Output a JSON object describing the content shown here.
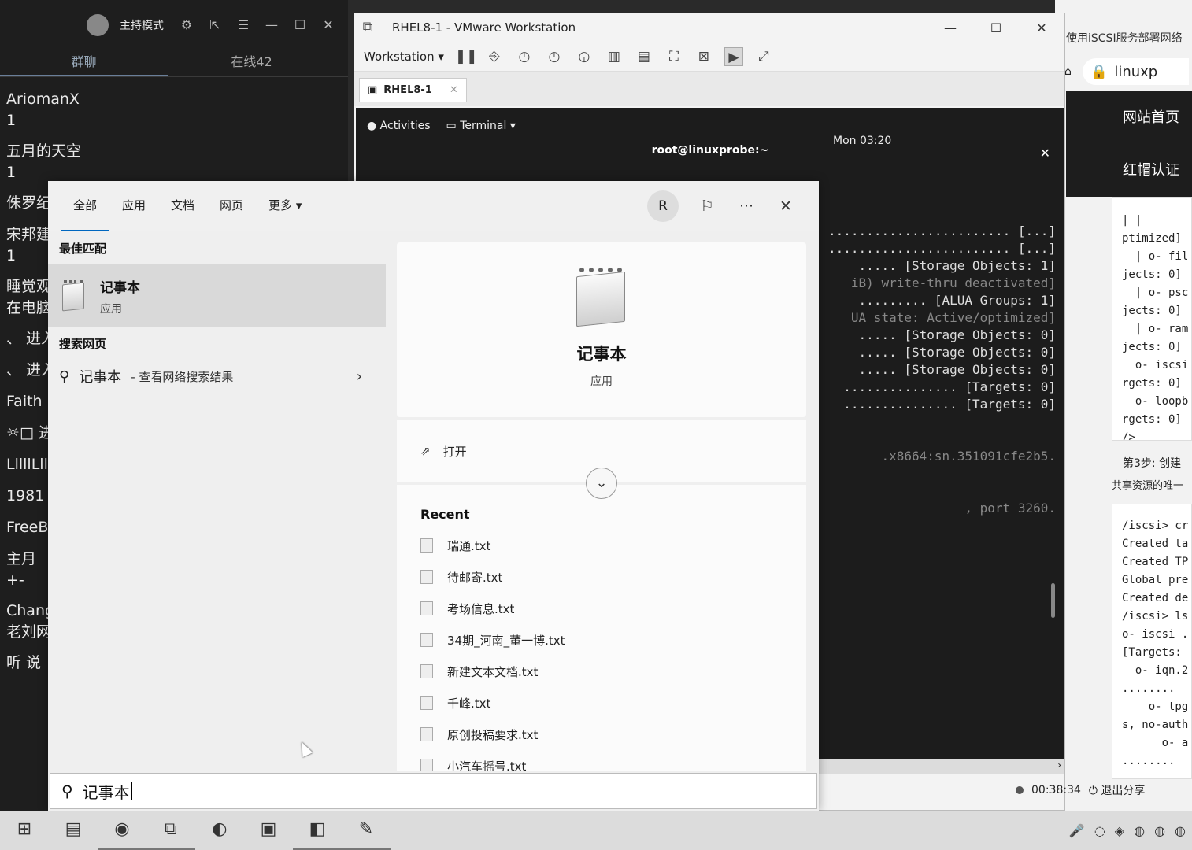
{
  "chat": {
    "mode_label": "主持模式",
    "tabs": [
      "群聊",
      "在线42"
    ],
    "messages": [
      {
        "name": "AriomanX",
        "text": "1"
      },
      {
        "name": "五月的天空",
        "text": "1"
      },
      {
        "name": "侏罗纪",
        "text": ""
      },
      {
        "name": "宋邦建",
        "text": "1"
      },
      {
        "name": "睡觉观",
        "text": "在电脑"
      },
      {
        "name": "、 进入",
        "text": ""
      },
      {
        "name": "、 进入",
        "text": ""
      },
      {
        "name": "Faith",
        "text": ""
      },
      {
        "name": "☼□ 进",
        "text": ""
      },
      {
        "name": "LllllLll",
        "text": ""
      },
      {
        "name": "1981",
        "text": ""
      },
      {
        "name": "FreeB",
        "text": ""
      },
      {
        "name": "主月",
        "text": "+-"
      },
      {
        "name": "Chang",
        "text": "老刘网"
      },
      {
        "name": "听 说",
        "text": ""
      }
    ]
  },
  "browser": {
    "tab_title": "使用iSCSI服务部署网络",
    "address": "linuxp",
    "nav": [
      "网站首页",
      "红帽认证"
    ],
    "code1": "| |\nptimized]\n  | o- fil\njects: 0]\n  | o- psc\njects: 0]\n  | o- ram\njects: 0]\n  o- iscsi\nrgets: 0]\n  o- loopb\nrgets: 0]\n/>",
    "step_title": "第3步: 创建",
    "step_desc": "共享资源的唯一",
    "code2": "/iscsi> cr\nCreated ta\nCreated TP\nGlobal pre\nCreated de\n/iscsi> ls\no- iscsi .\n[Targets:\n  o- iqn.2\n........\n    o- tpg\ns, no-auth\n      o- a\n........"
  },
  "vmware": {
    "title": "RHEL8-1 - VMware Workstation",
    "menu_label": "Workstation",
    "vm_tab": "RHEL8-1",
    "guest": {
      "activities": "Activities",
      "terminal_menu": "Terminal",
      "clock": "Mon 03:20",
      "terminal_title": "root@linuxprobe:~",
      "lines": [
        {
          "text": "........................ [...]",
          "dim": false
        },
        {
          "text": "........................ [...]",
          "dim": false
        },
        {
          "text": "..... [Storage Objects: 1]",
          "dim": false
        },
        {
          "text": "iB) write-thru deactivated]",
          "dim": true
        },
        {
          "text": "......... [ALUA Groups: 1]",
          "dim": false
        },
        {
          "text": "UA state: Active/optimized]",
          "dim": true
        },
        {
          "text": "..... [Storage Objects: 0]",
          "dim": false
        },
        {
          "text": "..... [Storage Objects: 0]",
          "dim": false
        },
        {
          "text": "..... [Storage Objects: 0]",
          "dim": false
        },
        {
          "text": "............... [Targets: 0]",
          "dim": false
        },
        {
          "text": "............... [Targets: 0]",
          "dim": false
        },
        {
          "text": "",
          "dim": false
        },
        {
          "text": "",
          "dim": false
        },
        {
          "text": ".x8664:sn.351091cfe2b5.",
          "dim": true
        },
        {
          "text": "",
          "dim": false
        },
        {
          "text": "",
          "dim": false
        },
        {
          "text": ", port 3260.",
          "dim": true
        }
      ]
    }
  },
  "share": {
    "timer": "00:38:34",
    "exit_label": "退出分享"
  },
  "search": {
    "filters": [
      "全部",
      "应用",
      "文档",
      "网页",
      "更多"
    ],
    "user_initial": "R",
    "best_match_header": "最佳匹配",
    "best_match_title": "记事本",
    "best_match_sub": "应用",
    "web_header": "搜索网页",
    "web_query": "记事本",
    "web_hint": " - 查看网络搜索结果",
    "detail_title": "记事本",
    "detail_sub": "应用",
    "open_label": "打开",
    "recent_header": "Recent",
    "recent_files": [
      "瑞通.txt",
      "待邮寄.txt",
      "考场信息.txt",
      "34期_河南_董一博.txt",
      "新建文本文档.txt",
      "千峰.txt",
      "原创投稿要求.txt",
      "小汽车摇号.txt"
    ],
    "query": "记事本"
  }
}
